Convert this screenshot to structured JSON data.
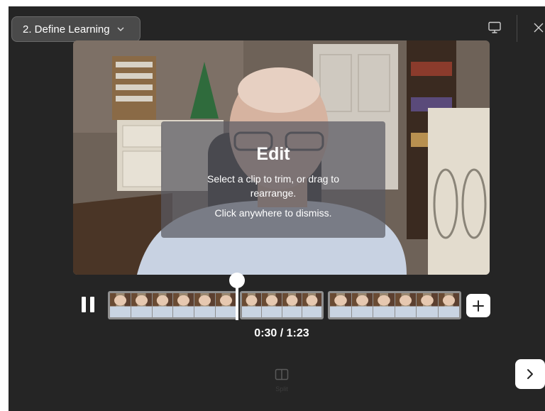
{
  "header": {
    "section_selector": "2. Define Learning",
    "icons": {
      "dropdown": "chevron-down-icon",
      "cast": "monitor-icon",
      "close": "close-icon"
    }
  },
  "overlay": {
    "title": "Edit",
    "description": "Select a clip to trim, or drag to rearrange.",
    "dismiss": "Click anywhere to dismiss."
  },
  "player": {
    "time_readout": "0:30 / 1:23",
    "icons": {
      "pause": "pause-icon",
      "add_clip": "plus-icon",
      "split": "split-icon",
      "next": "chevron-right-icon"
    },
    "split_label": "Split"
  },
  "timeline": {
    "clip_count": 3,
    "thumbnails_per_clip": [
      6,
      4,
      6
    ]
  },
  "colors": {
    "background": "#252525",
    "dropdown_bg": "#4a4a4a",
    "text": "#ffffff",
    "overlay_bg": "#5a5a62"
  }
}
